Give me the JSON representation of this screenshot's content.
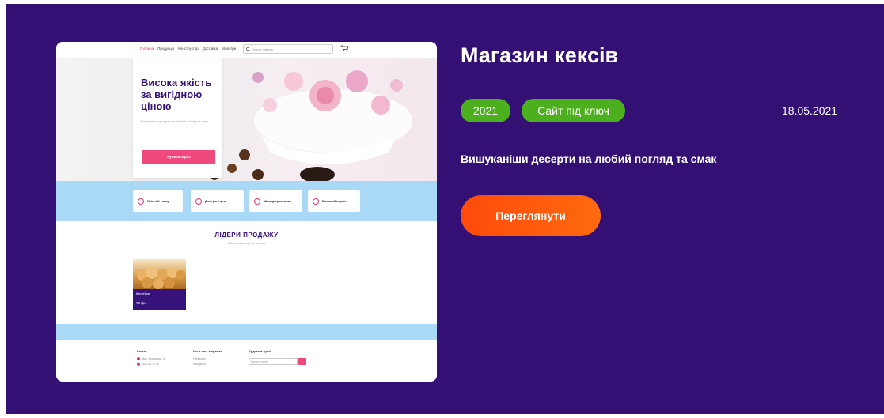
{
  "project": {
    "title": "Магазин кексів",
    "badges": [
      "2021",
      "Сайт під ключ"
    ],
    "date": "18.05.2021",
    "description": "Вишуканіши десерти на любий погляд та смак",
    "view_button": "Переглянути",
    "colors": {
      "background": "#341075",
      "badge": "#4caf1e",
      "button": "#ff5a0c"
    }
  },
  "preview": {
    "nav": {
      "links": [
        "Головна",
        "Продукція",
        "Конструктор",
        "Доставка",
        "Майстри"
      ],
      "search_placeholder": "Пошук товарів",
      "cart_icon": "cart-icon"
    },
    "hero": {
      "title": "Висока якість за вигідною ціною",
      "subtitle": "Вишуканіші десерти на любий погляд та смак",
      "button": "Купити зараз"
    },
    "features": [
      "Якісний товар",
      "Доступні ціни",
      "Швидка доставка",
      "Високий сервіс"
    ],
    "leaders": {
      "title": "ЛІДЕРИ ПРОДАЖУ",
      "subtitle": "Оберіть кекс, торт чи тістечко"
    },
    "product": {
      "name": "Капкейки",
      "price": "79 грн."
    },
    "footer": {
      "col1": {
        "title": "Кекси",
        "address": "вул. Хрещатик, 10",
        "phone": "000-00-70-00"
      },
      "col2": {
        "title": "Ми в соц. мережах",
        "link1": "Facebook",
        "link2": "Instagram"
      },
      "col3": {
        "title": "Будьте в курсі",
        "input_placeholder": "Введіть email"
      }
    }
  }
}
